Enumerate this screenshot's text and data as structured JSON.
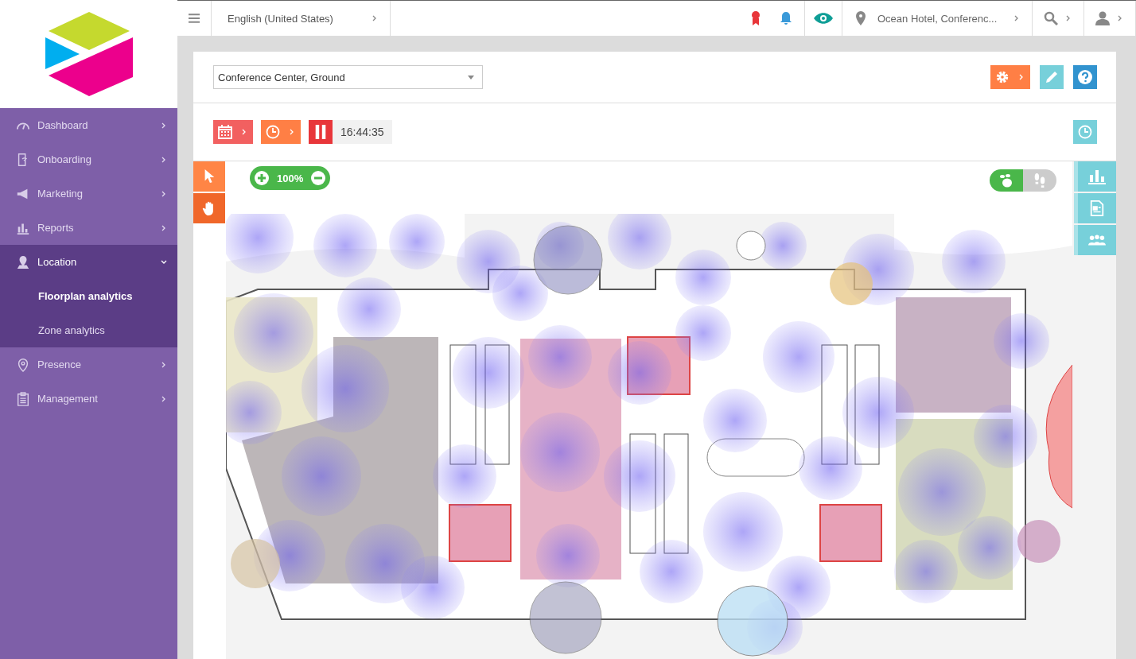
{
  "sidebar": {
    "items": [
      {
        "label": "Dashboard",
        "kind": "gauge",
        "expanded": false
      },
      {
        "label": "Onboarding",
        "kind": "phone",
        "expanded": false
      },
      {
        "label": "Marketing",
        "kind": "megaphone",
        "expanded": false
      },
      {
        "label": "Reports",
        "kind": "bars",
        "expanded": false
      },
      {
        "label": "Location",
        "kind": "pinmap",
        "expanded": true,
        "children": [
          {
            "label": "Floorplan analytics",
            "selected": true
          },
          {
            "label": "Zone analytics",
            "selected": false
          }
        ]
      },
      {
        "label": "Presence",
        "kind": "pin",
        "expanded": false
      },
      {
        "label": "Management",
        "kind": "clipboard",
        "expanded": false
      }
    ]
  },
  "topbar": {
    "language": "English (United States)",
    "location": "Ocean Hotel, Conferenc..."
  },
  "floor_select": {
    "value": "Conference Center, Ground"
  },
  "playback": {
    "time": "16:44:35"
  },
  "map": {
    "zoom": "100%",
    "tools": [
      {
        "kind": "pointer",
        "selected": false
      },
      {
        "kind": "hand",
        "selected": true
      }
    ],
    "view_toggle": [
      {
        "kind": "footprint",
        "selected": true
      },
      {
        "kind": "steps",
        "selected": false
      }
    ],
    "side_tabs": [
      {
        "kind": "chart"
      },
      {
        "kind": "report"
      },
      {
        "kind": "people"
      }
    ]
  }
}
